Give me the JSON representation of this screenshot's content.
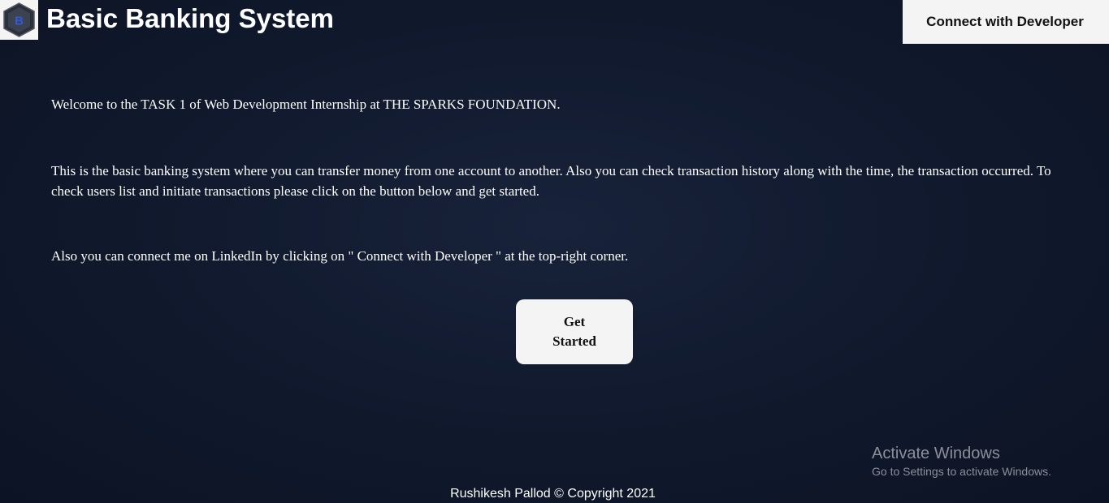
{
  "header": {
    "logo_letter": "B",
    "title": "Basic Banking System",
    "connect_button_label": "Connect with Developer"
  },
  "main": {
    "paragraphs": [
      "Welcome to the TASK 1 of Web Development Internship at THE SPARKS FOUNDATION.",
      "This is the basic banking system where you can transfer money from one account to another. Also you can check transaction history along with the time, the transaction occurred. To check users list and initiate transactions please click on the button below and get started.",
      "Also you can connect me on LinkedIn by clicking on \" Connect with Developer \" at the top-right corner."
    ],
    "get_started_label": "Get Started"
  },
  "watermark": {
    "title": "Activate Windows",
    "subtitle": "Go to Settings to activate Windows."
  },
  "footer": {
    "text": "Rushikesh Pallod © Copyright 2021"
  },
  "colors": {
    "background": "#111a2e",
    "button_bg": "#f4f4f4",
    "logo_hexagon": "#3d4250",
    "logo_letter": "#2f5bd8"
  },
  "icons": {
    "logo": "hexagon-b-logo-icon"
  }
}
